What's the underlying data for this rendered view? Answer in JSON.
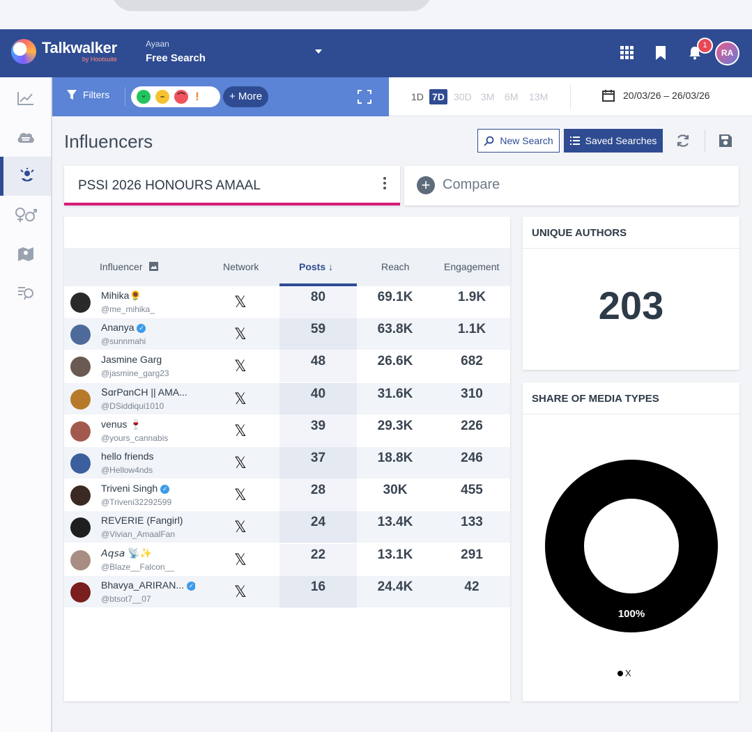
{
  "header": {
    "brand": "Talkwalker",
    "brand_sub": "by Hootsuite",
    "user_name": "Ayaan",
    "search_type": "Free Search",
    "notification_count": "1",
    "avatar_initials": "RA"
  },
  "toolbar": {
    "filters_label": "Filters",
    "more_label": "+ More",
    "sentiments": [
      "positive",
      "neutral",
      "negative",
      "alert"
    ],
    "ranges": [
      "1D",
      "7D",
      "30D",
      "3M",
      "6M",
      "13M"
    ],
    "active_range": "7D",
    "date_range": "20/03/26 – 26/03/26"
  },
  "page": {
    "title": "Influencers",
    "new_search_label": "New Search",
    "saved_searches_label": "Saved Searches"
  },
  "query": {
    "label": "PSSI 2026 HONOURS AMAAL",
    "compare_label": "Compare"
  },
  "table": {
    "headers": {
      "influencer": "Influencer",
      "network": "Network",
      "posts": "Posts",
      "reach": "Reach",
      "engagement": "Engagement"
    },
    "network_glyph": "𝕏",
    "rows": [
      {
        "name": "Mihika🌻",
        "handle": "@me_mihika_",
        "verified": false,
        "posts": "80",
        "reach": "69.1K",
        "engagement": "1.9K",
        "avatar_color": "#2a2a2a"
      },
      {
        "name": "Ananya",
        "handle": "@sunnmahi",
        "verified": true,
        "posts": "59",
        "reach": "63.8K",
        "engagement": "1.1K",
        "avatar_color": "#4d6a9a"
      },
      {
        "name": "Jasmine Garg",
        "handle": "@jasmine_garg23",
        "verified": false,
        "posts": "48",
        "reach": "26.6K",
        "engagement": "682",
        "avatar_color": "#6b5a52"
      },
      {
        "name": "ՏɑrPɑnCH || AMA...",
        "handle": "@DSiddiqui1010",
        "verified": false,
        "posts": "40",
        "reach": "31.6K",
        "engagement": "310",
        "avatar_color": "#b7792a"
      },
      {
        "name": "venus 🍷",
        "handle": "@yours_cannabis",
        "verified": false,
        "posts": "39",
        "reach": "29.3K",
        "engagement": "226",
        "avatar_color": "#a4594f"
      },
      {
        "name": "hello friends",
        "handle": "@Hellow4nds",
        "verified": false,
        "posts": "37",
        "reach": "18.8K",
        "engagement": "246",
        "avatar_color": "#3a5f9c"
      },
      {
        "name": "Triveni Singh",
        "handle": "@Triveni32292599",
        "verified": true,
        "posts": "28",
        "reach": "30K",
        "engagement": "455",
        "avatar_color": "#3b2a22"
      },
      {
        "name": "REVERIE (Fangirl)",
        "handle": "@Vivian_AmaalFan",
        "verified": false,
        "posts": "24",
        "reach": "13.4K",
        "engagement": "133",
        "avatar_color": "#1f1f1f"
      },
      {
        "name": "𝘈𝘲𝘴𝘢 📡✨",
        "handle": "@Blaze__Falcon__",
        "verified": false,
        "posts": "22",
        "reach": "13.1K",
        "engagement": "291",
        "avatar_color": "#a88d82"
      },
      {
        "name": "Bhavya_ARIRAN...",
        "handle": "@btsot7__07",
        "verified": true,
        "posts": "16",
        "reach": "24.4K",
        "engagement": "42",
        "avatar_color": "#7a1e1e"
      }
    ]
  },
  "authors": {
    "title": "UNIQUE AUTHORS",
    "value": "203"
  },
  "media": {
    "title": "SHARE OF MEDIA TYPES",
    "percent_label": "100%",
    "legend_label": "X",
    "share": 1.0,
    "color": "#000000"
  },
  "colors": {
    "header": "#2f4c92",
    "toolbar": "#5b83d6",
    "accent_pink": "#d81b78"
  }
}
